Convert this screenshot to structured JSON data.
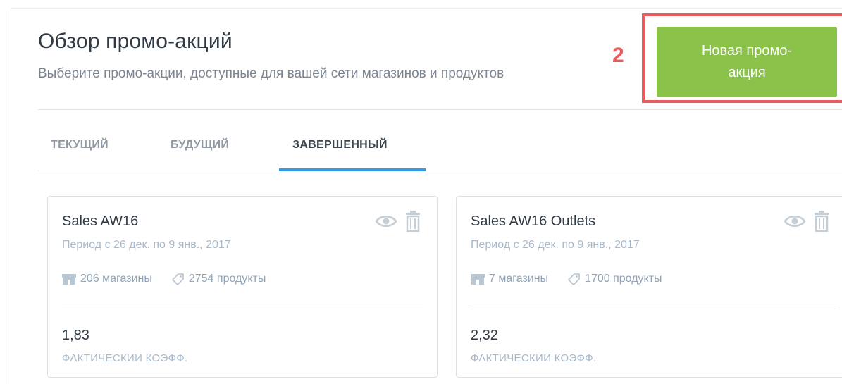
{
  "header": {
    "title": "Обзор промо-акций",
    "subtitle": "Выберите промо-акции, доступные для вашей сети магазинов и продуктов",
    "step_number": "2",
    "new_promo_label": "Новая промо-акция"
  },
  "tabs": [
    {
      "label": "ТЕКУЩИЙ",
      "active": false
    },
    {
      "label": "БУДУЩИЙ",
      "active": false
    },
    {
      "label": "ЗАВЕРШЕННЫЙ",
      "active": true
    }
  ],
  "cards": [
    {
      "name": "Sales AW16",
      "period": "Период с 26 дек. по 9 янв., 2017",
      "stores": "206 магазины",
      "products": "2754 продукты",
      "value": "1,83",
      "value_label": "ФАКТИЧЕСКИИ КОЭФФ."
    },
    {
      "name": "Sales AW16 Outlets",
      "period": "Период с 26 дек. по 9 янв., 2017",
      "stores": "7 магазины",
      "products": "1700 продукты",
      "value": "2,32",
      "value_label": "ФАКТИЧЕСКИИ КОЭФФ."
    }
  ],
  "colors": {
    "accent_green": "#8bc34a",
    "highlight_red": "#ec5b5b",
    "tab_indicator_blue": "#2f9be8"
  }
}
